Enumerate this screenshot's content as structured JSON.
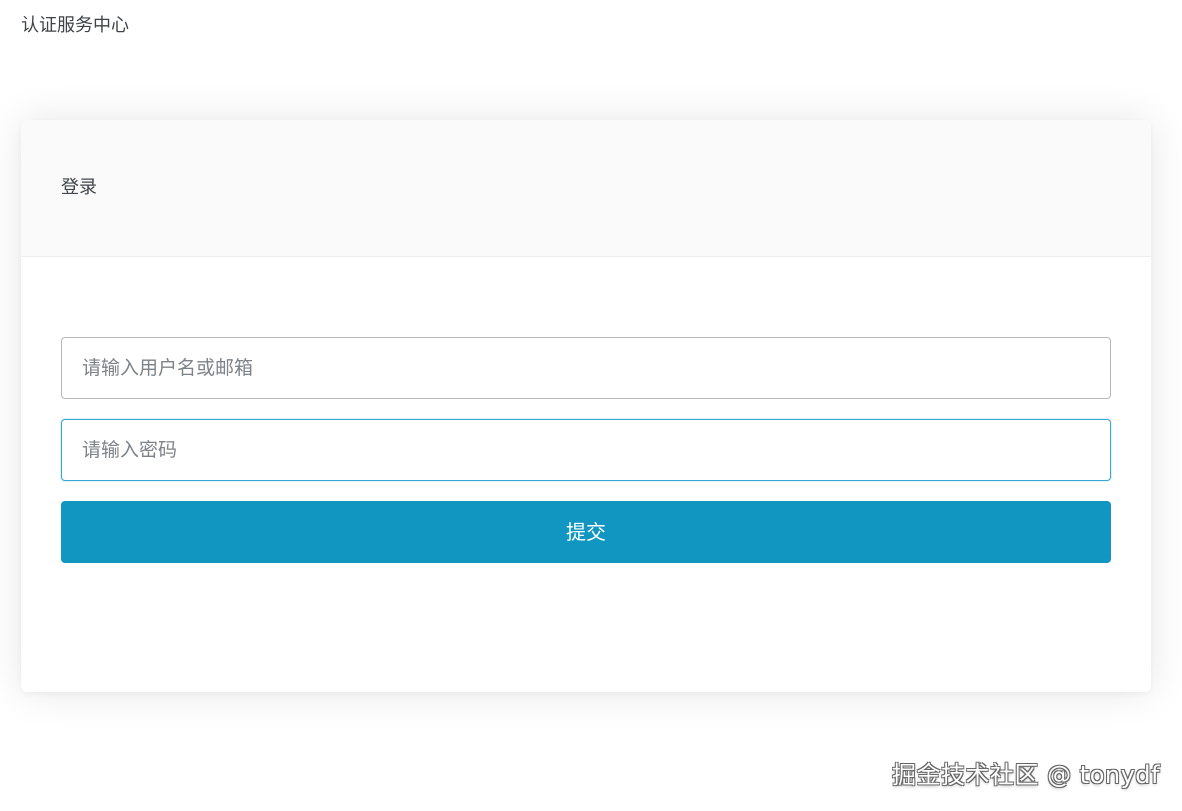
{
  "header": {
    "title": "认证服务中心"
  },
  "login": {
    "title": "登录",
    "username": {
      "value": "",
      "placeholder": "请输入用户名或邮箱"
    },
    "password": {
      "value": "",
      "placeholder": "请输入密码"
    },
    "submit_label": "提交"
  },
  "watermark": {
    "text": "掘金技术社区 @ tonydf"
  },
  "colors": {
    "primary": "#1196c2",
    "focus_border": "#35a7d3",
    "text": "#3f4448",
    "placeholder": "#7d8389"
  }
}
